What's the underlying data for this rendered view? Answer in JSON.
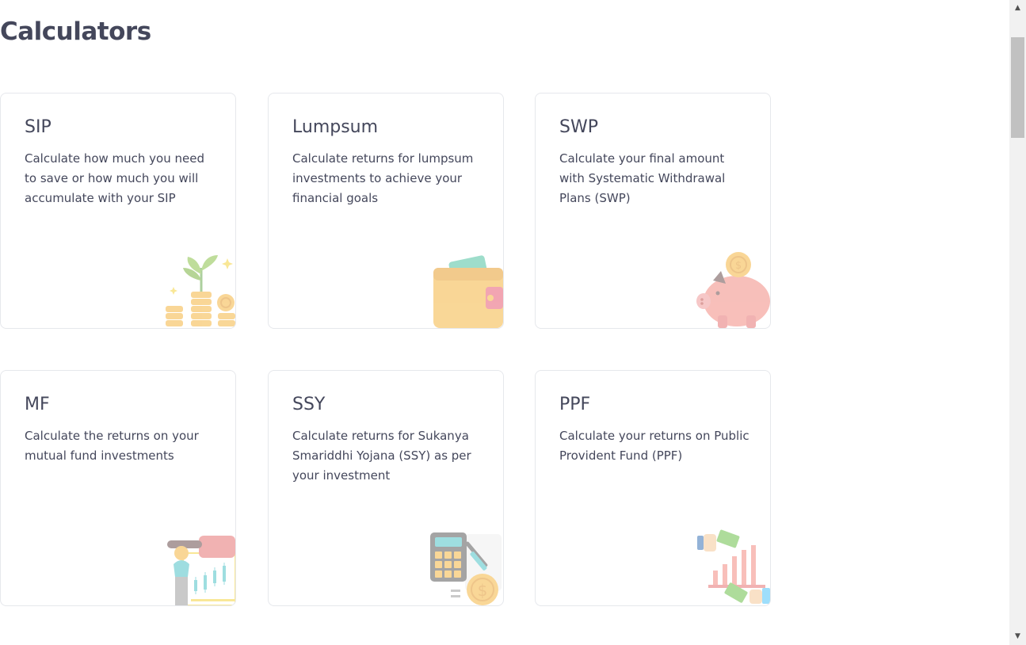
{
  "page": {
    "title": "Calculators"
  },
  "cards": [
    {
      "title": "SIP",
      "description": "Calculate how much you need to save or how much you will accumulate with your SIP",
      "icon": "coins-plant-icon"
    },
    {
      "title": "Lumpsum",
      "description": "Calculate returns for lumpsum investments to achieve your financial goals",
      "icon": "wallet-icon"
    },
    {
      "title": "SWP",
      "description": "Calculate your final amount with Systematic Withdrawal Plans (SWP)",
      "icon": "piggy-bank-icon"
    },
    {
      "title": "MF",
      "description": "Calculate the returns on your mutual fund investments",
      "icon": "investor-chart-icon"
    },
    {
      "title": "SSY",
      "description": "Calculate returns for Sukanya Smariddhi Yojana (SSY) as per your investment",
      "icon": "calculator-coin-icon"
    },
    {
      "title": "PPF",
      "description": "Calculate your returns on Public Provident Fund (PPF)",
      "icon": "money-growth-chart-icon"
    }
  ],
  "scrollbar": {
    "up_arrow": "▲",
    "down_arrow": "▼"
  }
}
